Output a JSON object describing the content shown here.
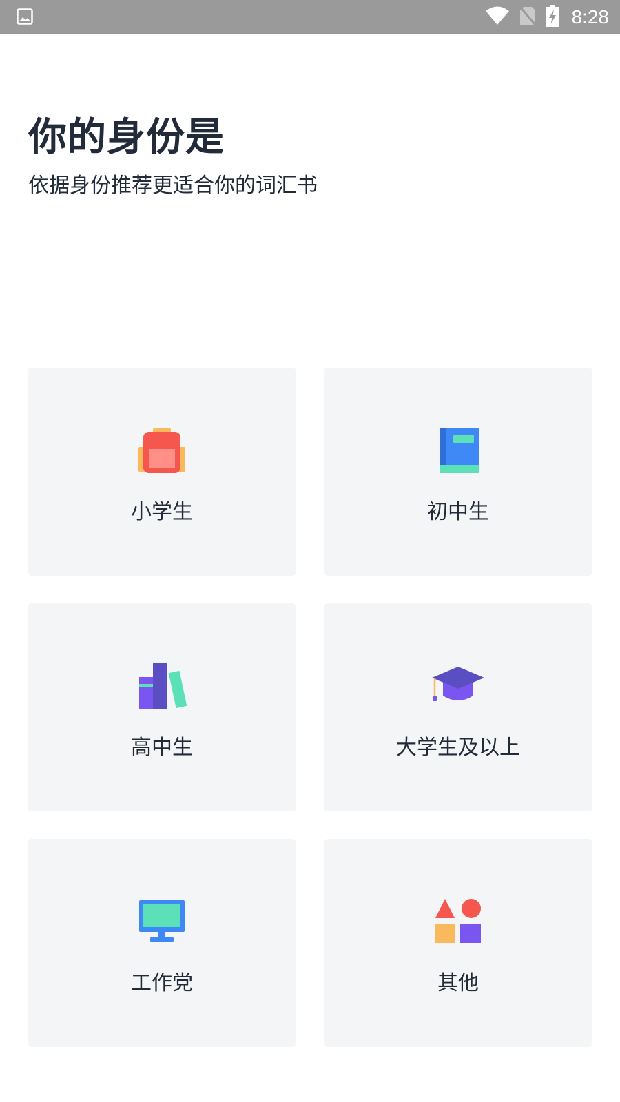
{
  "status_bar": {
    "time": "8:28",
    "icons": [
      "image-icon",
      "wifi-icon",
      "no-sim-icon",
      "battery-charging-icon"
    ]
  },
  "header": {
    "title": "你的身份是",
    "subtitle": "依据身份推荐更适合你的词汇书"
  },
  "options": [
    {
      "label": "小学生",
      "icon": "backpack-icon"
    },
    {
      "label": "初中生",
      "icon": "book-icon"
    },
    {
      "label": "高中生",
      "icon": "books-icon"
    },
    {
      "label": "大学生及以上",
      "icon": "graduation-cap-icon"
    },
    {
      "label": "工作党",
      "icon": "monitor-icon"
    },
    {
      "label": "其他",
      "icon": "shapes-icon"
    }
  ],
  "colors": {
    "text": "#222b3a",
    "card_bg": "#f4f5f7",
    "status_bar_bg": "#9a9a9a"
  }
}
